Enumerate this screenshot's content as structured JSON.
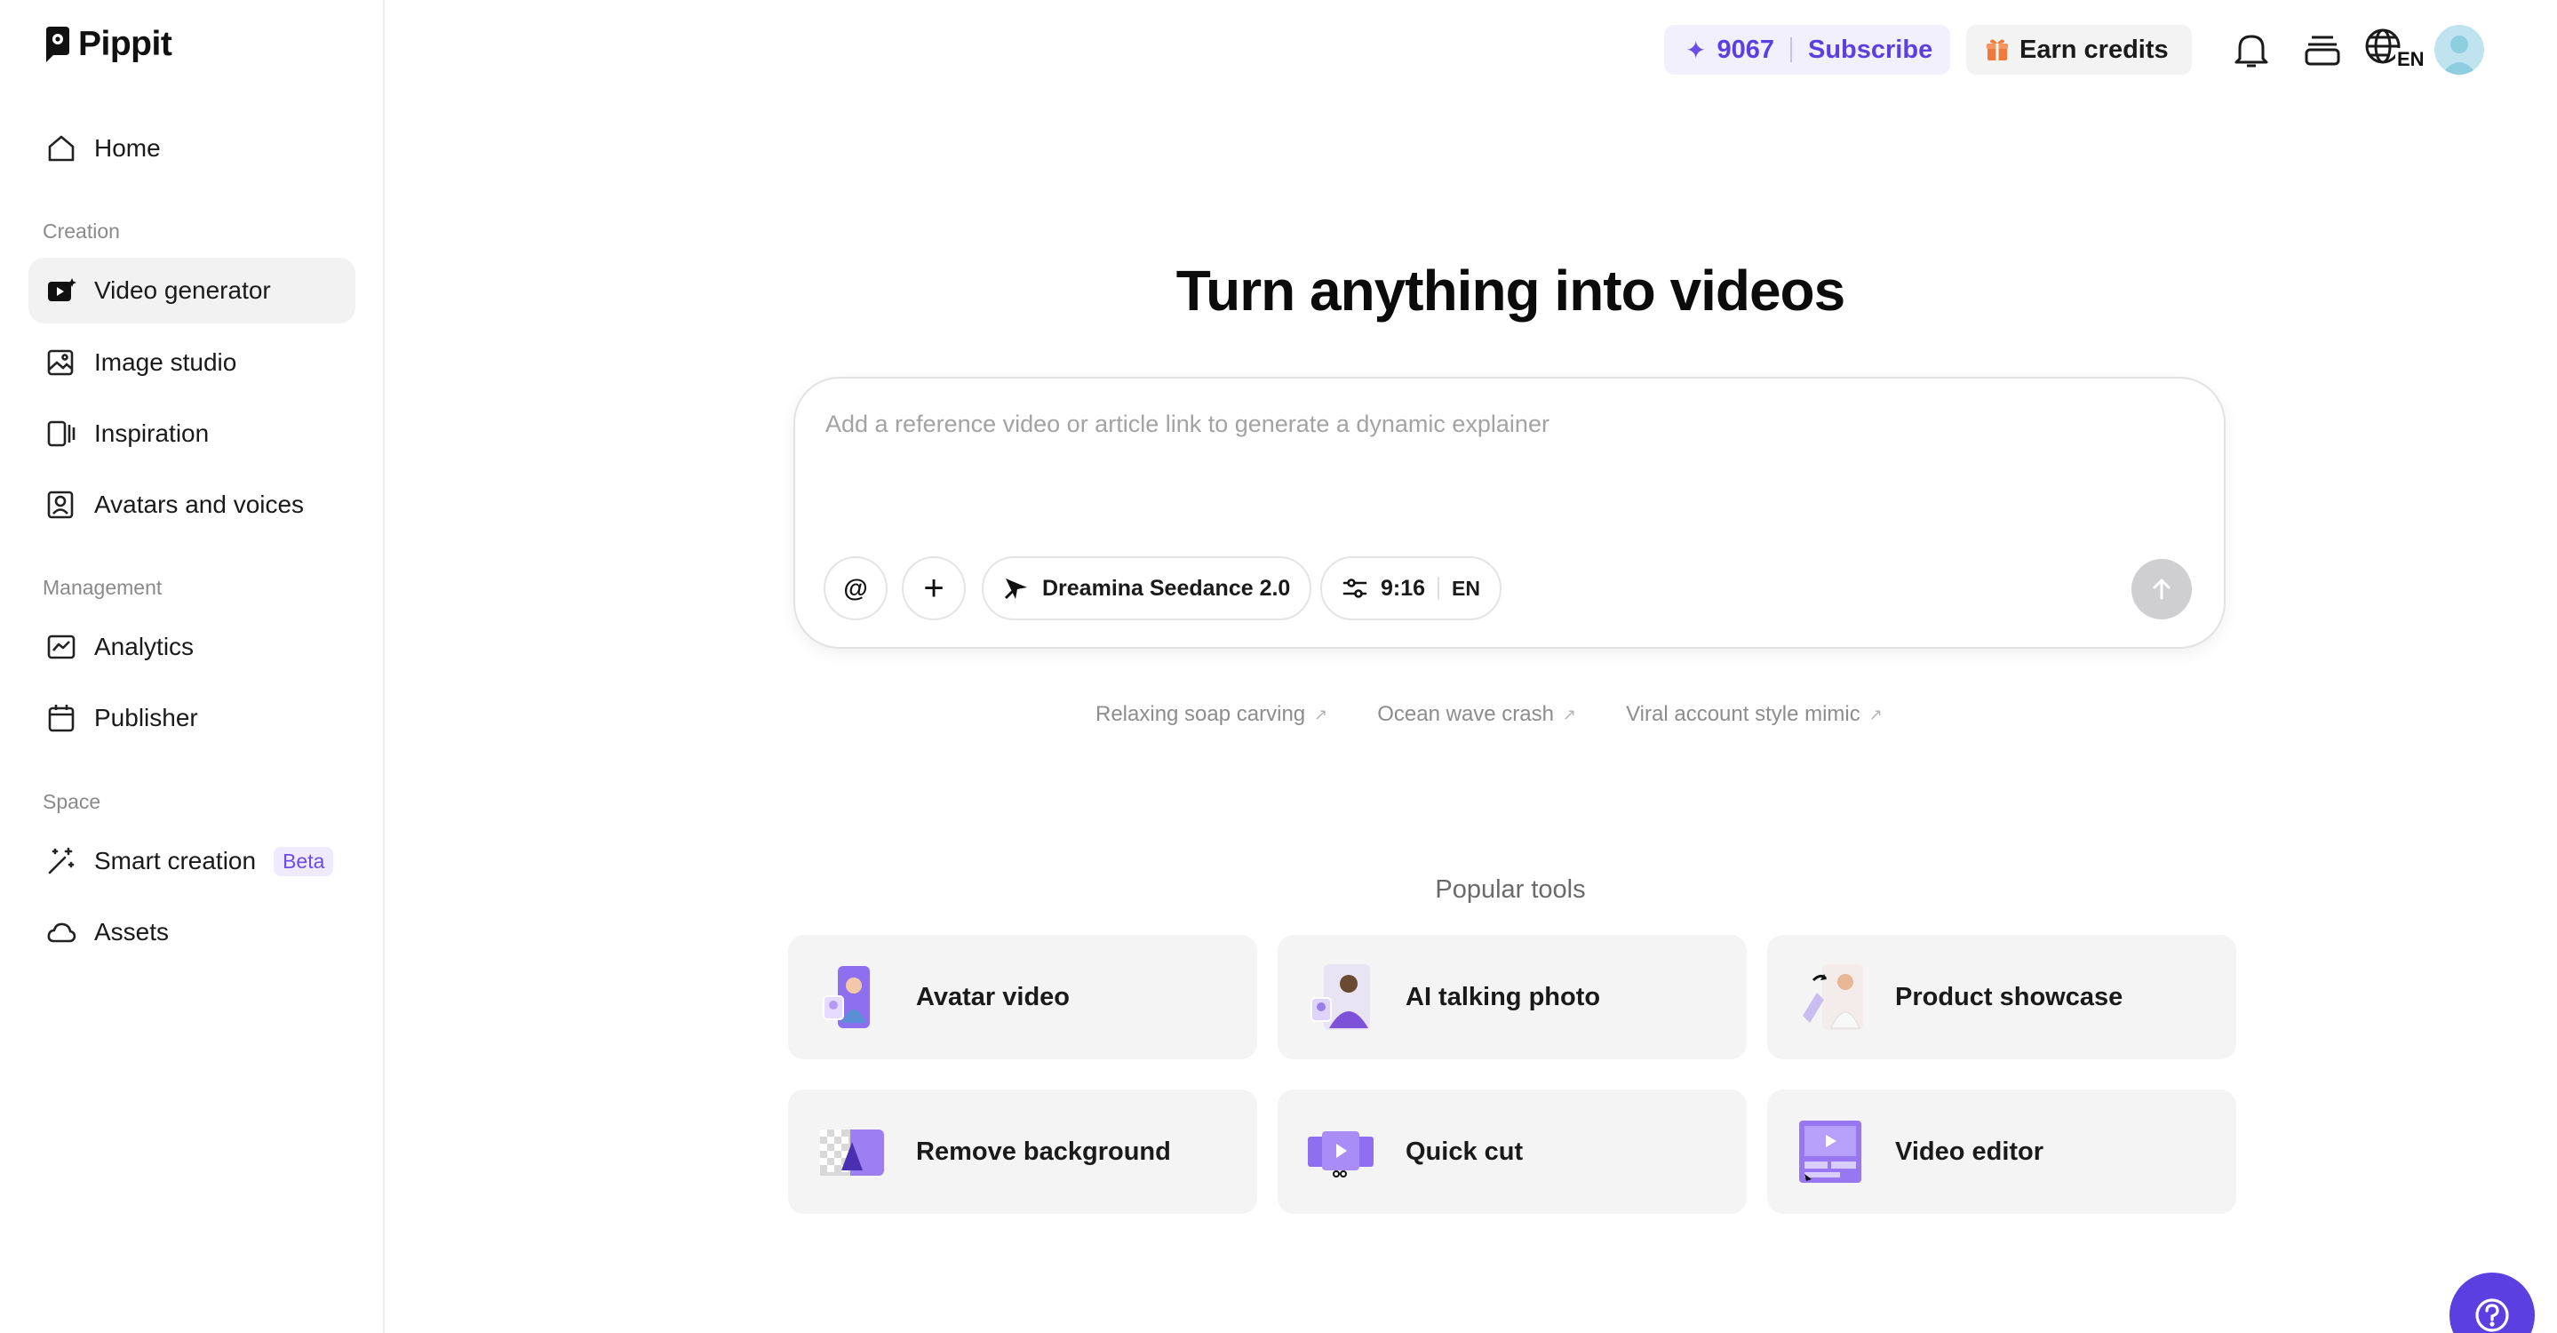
{
  "app": {
    "brand": "Pippit"
  },
  "sidebar": {
    "home": "Home",
    "sections": {
      "creation": "Creation",
      "management": "Management",
      "space": "Space"
    },
    "creation_items": [
      {
        "label": "Video generator",
        "icon": "video-generator-icon",
        "active": true
      },
      {
        "label": "Image studio",
        "icon": "image-studio-icon",
        "active": false
      },
      {
        "label": "Inspiration",
        "icon": "inspiration-icon",
        "active": false
      },
      {
        "label": "Avatars and voices",
        "icon": "avatar-voice-icon",
        "active": false
      }
    ],
    "management_items": [
      {
        "label": "Analytics",
        "icon": "analytics-icon"
      },
      {
        "label": "Publisher",
        "icon": "calendar-icon"
      }
    ],
    "space_items": [
      {
        "label": "Smart creation",
        "icon": "magic-wand-icon",
        "badge": "Beta"
      },
      {
        "label": "Assets",
        "icon": "cloud-icon"
      }
    ]
  },
  "header": {
    "credits": "9067",
    "subscribe": "Subscribe",
    "earn_credits": "Earn credits",
    "language_badge": "EN",
    "colors": {
      "accent": "#5b3fe0",
      "accent_bg": "#f3f0fe"
    }
  },
  "main": {
    "title": "Turn anything into videos",
    "prompt": {
      "placeholder": "Add a reference video or article link to generate a dynamic explainer",
      "mention_symbol": "@",
      "add_symbol": "+",
      "model": "Dreamina Seedance 2.0",
      "aspect_ratio": "9:16",
      "language": "EN"
    },
    "suggestions": [
      "Relaxing soap carving",
      "Ocean wave crash",
      "Viral account style mimic"
    ],
    "popular_title": "Popular tools",
    "tools": [
      {
        "label": "Avatar video"
      },
      {
        "label": "AI talking photo"
      },
      {
        "label": "Product showcase"
      },
      {
        "label": "Remove background"
      },
      {
        "label": "Quick cut"
      },
      {
        "label": "Video editor"
      }
    ]
  }
}
